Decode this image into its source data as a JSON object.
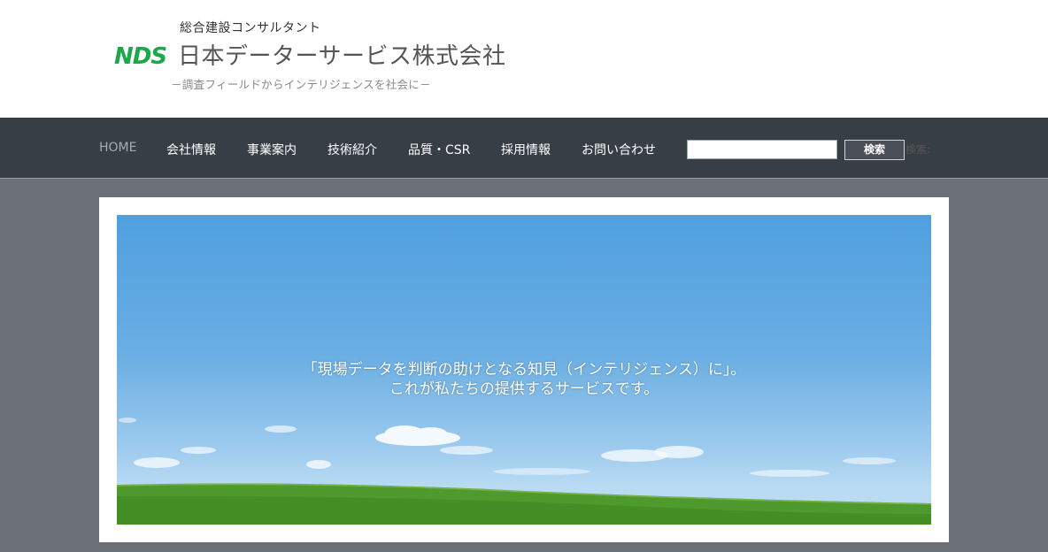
{
  "header": {
    "tagline_top": "総合建設コンサルタント",
    "logo_text": "NDS",
    "company_name": "日本データーサービス株式会社",
    "tagline_bottom": "－調査フィールドからインテリジェンスを社会に－"
  },
  "nav": {
    "items": [
      {
        "label": "HOME"
      },
      {
        "label": "会社情報"
      },
      {
        "label": "事業案内"
      },
      {
        "label": "技術紹介"
      },
      {
        "label": "品質・CSR"
      },
      {
        "label": "採用情報"
      },
      {
        "label": "お問い合わせ"
      }
    ],
    "search_value": "",
    "search_button": "検索",
    "search_label": "検索:"
  },
  "hero": {
    "line1": "「現場データを判断の助けとなる知見（インテリジェンス）に」。",
    "line2": "これが私たちの提供するサービスです。"
  },
  "colors": {
    "brand_green": "#1aa84a",
    "nav_bg": "#383e46",
    "page_bg": "#6b7079"
  }
}
